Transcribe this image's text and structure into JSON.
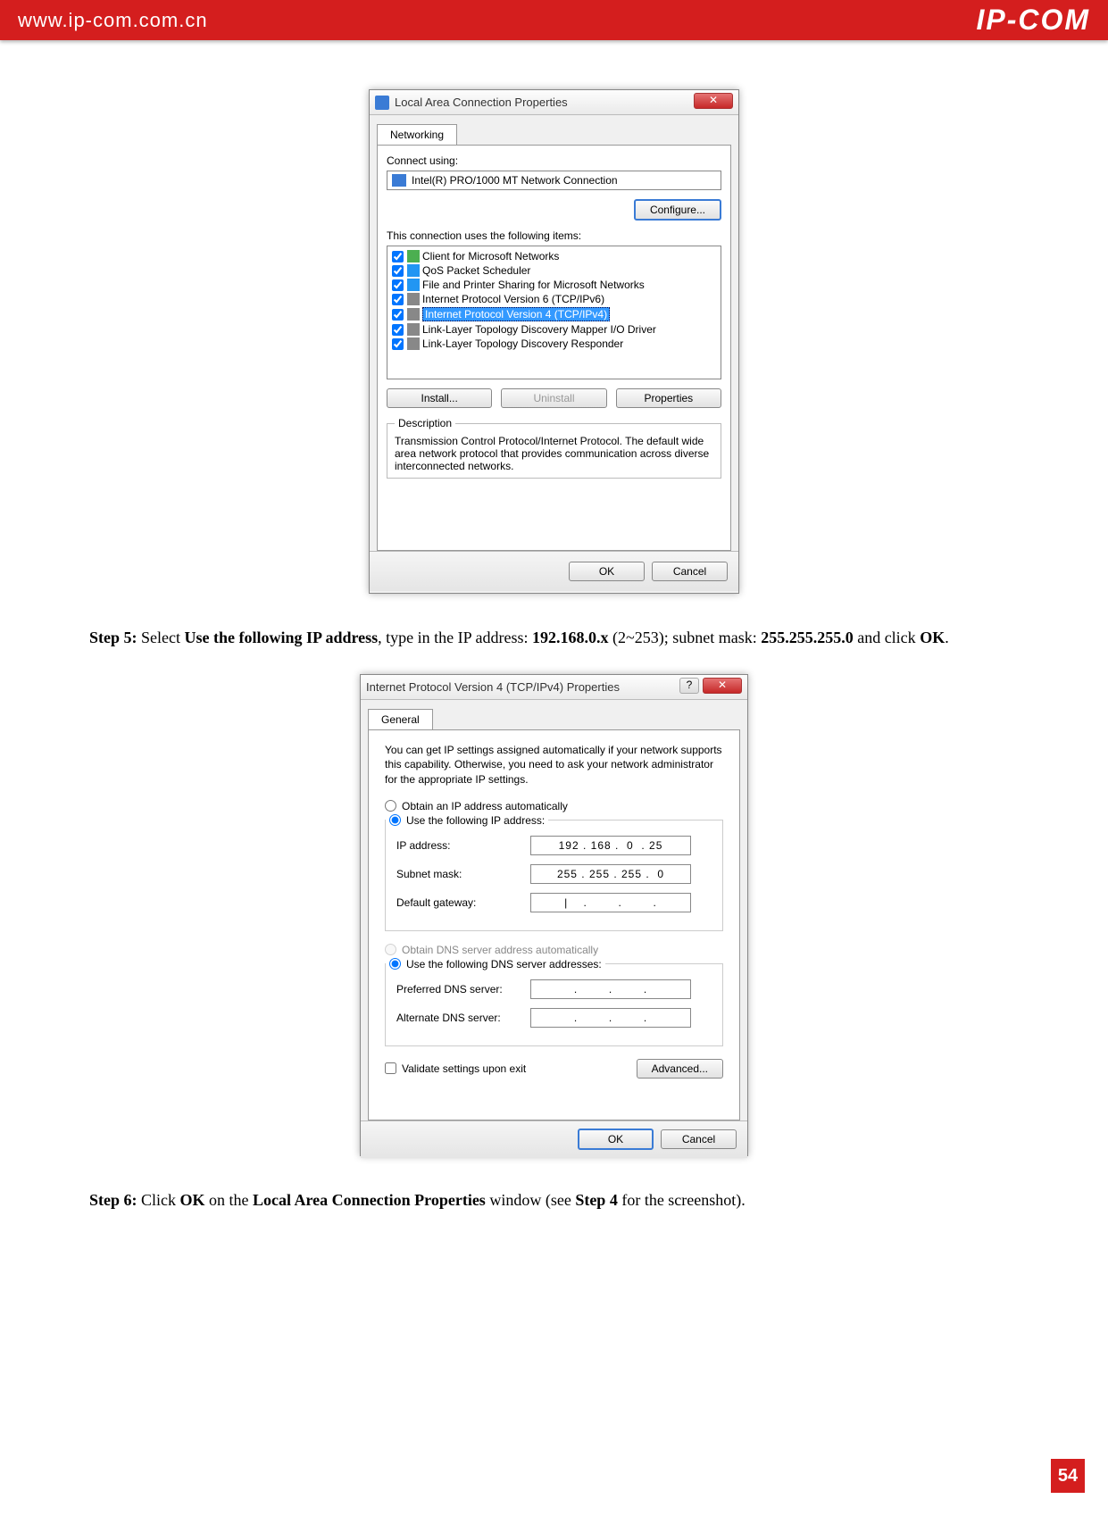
{
  "header": {
    "url": "www.ip-com.com.cn",
    "logo": "IP-COM"
  },
  "dialog1": {
    "title": "Local Area Connection Properties",
    "close": "✕",
    "tab": "Networking",
    "connect_label": "Connect using:",
    "adapter": "Intel(R) PRO/1000 MT Network Connection",
    "configure": "Configure...",
    "items_label": "This connection uses the following items:",
    "items": [
      "Client for Microsoft Networks",
      "QoS Packet Scheduler",
      "File and Printer Sharing for Microsoft Networks",
      "Internet Protocol Version 6 (TCP/IPv6)",
      "Internet Protocol Version 4 (TCP/IPv4)",
      "Link-Layer Topology Discovery Mapper I/O Driver",
      "Link-Layer Topology Discovery Responder"
    ],
    "install": "Install...",
    "uninstall": "Uninstall",
    "properties": "Properties",
    "desc_title": "Description",
    "desc": "Transmission Control Protocol/Internet Protocol. The default wide area network protocol that provides communication across diverse interconnected networks.",
    "ok": "OK",
    "cancel": "Cancel"
  },
  "step5": {
    "prefix": "Step 5:",
    "t1": " Select ",
    "b1": "Use the following IP address",
    "t2": ", type in the IP address: ",
    "b2": "192.168.0.x",
    "t3": " (2~253); subnet mask: ",
    "b3": "255.255.255.0",
    "t4": " and click ",
    "b4": "OK",
    "t5": "."
  },
  "dialog2": {
    "title": "Internet Protocol Version 4 (TCP/IPv4) Properties",
    "help": "?",
    "close": "✕",
    "tab": "General",
    "info": "You can get IP settings assigned automatically if your network supports this capability. Otherwise, you need to ask your network administrator for the appropriate IP settings.",
    "radio_auto_ip": "Obtain an IP address automatically",
    "radio_static_ip": "Use the following IP address:",
    "ip_label": "IP address:",
    "ip_value": "192 . 168 .  0  . 25",
    "subnet_label": "Subnet mask:",
    "subnet_value": "255 . 255 . 255 .  0",
    "gateway_label": "Default gateway:",
    "gateway_value": "|    .        .        .",
    "radio_auto_dns": "Obtain DNS server address automatically",
    "radio_static_dns": "Use the following DNS server addresses:",
    "pdns_label": "Preferred DNS server:",
    "pdns_value": ".        .        .",
    "adns_label": "Alternate DNS server:",
    "adns_value": ".        .        .",
    "validate": "Validate settings upon exit",
    "advanced": "Advanced...",
    "ok": "OK",
    "cancel": "Cancel"
  },
  "step6": {
    "prefix": "Step 6:",
    "t1": " Click ",
    "b1": "OK",
    "t2": " on the ",
    "b2": "Local Area Connection Properties",
    "t3": " window (see ",
    "b3": "Step 4",
    "t4": " for the screenshot)."
  },
  "page_number": "54"
}
